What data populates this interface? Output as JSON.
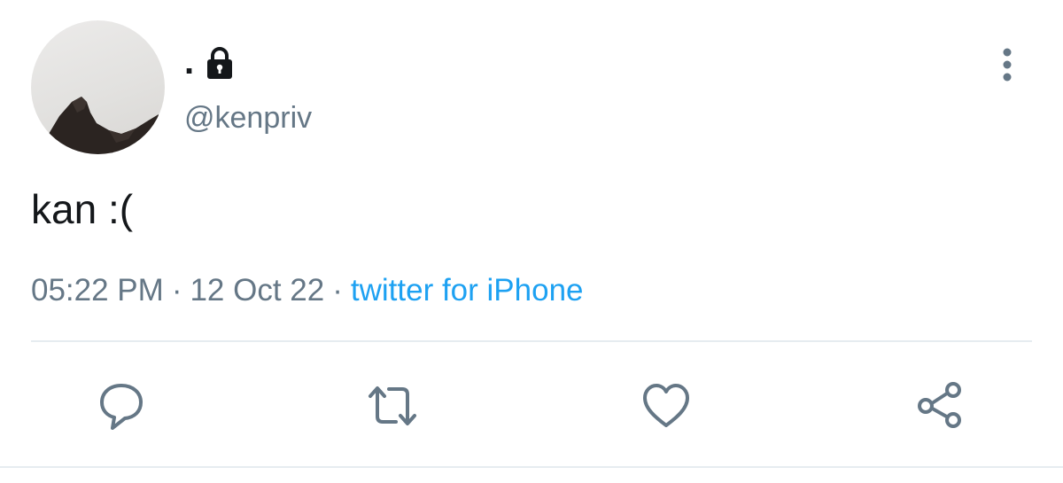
{
  "tweet": {
    "author": {
      "display_name": ".",
      "handle": "@kenpriv",
      "protected_icon": "lock-icon",
      "avatar": "profile-photo"
    },
    "text": "kan :(",
    "time": "05:22 PM",
    "date": "12 Oct 22",
    "separator": "·",
    "source": "twitter for iPhone",
    "menu_icon": "more-vertical-icon",
    "actions": [
      {
        "name": "reply",
        "icon": "reply-icon"
      },
      {
        "name": "retweet",
        "icon": "retweet-icon"
      },
      {
        "name": "like",
        "icon": "heart-icon"
      },
      {
        "name": "share",
        "icon": "share-icon"
      }
    ]
  },
  "colors": {
    "text_primary": "#14171a",
    "text_secondary": "#657786",
    "accent": "#1da1f2",
    "divider": "#e6ecf0"
  }
}
